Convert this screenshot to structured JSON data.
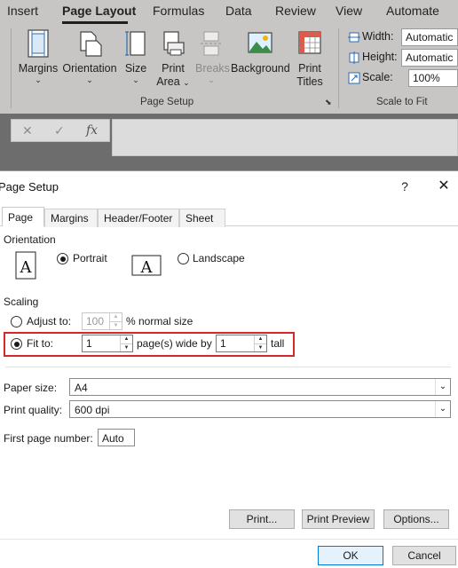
{
  "ribbon": {
    "tabs": [
      {
        "label": "Insert"
      },
      {
        "label": "Page Layout"
      },
      {
        "label": "Formulas"
      },
      {
        "label": "Data"
      },
      {
        "label": "Review"
      },
      {
        "label": "View"
      },
      {
        "label": "Automate"
      }
    ],
    "page_setup": {
      "margins": "Margins",
      "orientation": "Orientation",
      "size": "Size",
      "print_area_1": "Print",
      "print_area_2": "Area",
      "breaks": "Breaks",
      "background": "Background",
      "print_titles_1": "Print",
      "print_titles_2": "Titles",
      "group_label": "Page Setup"
    },
    "scale_to_fit": {
      "width_label": "Width:",
      "width_value": "Automatic",
      "height_label": "Height:",
      "height_value": "Automatic",
      "scale_label": "Scale:",
      "scale_value": "100%",
      "group_label": "Scale to Fit"
    },
    "chevron": "⌄"
  },
  "formula_bar": {
    "cancel": "✕",
    "enter": "✓",
    "fx": "fx"
  },
  "dialog": {
    "title": "Page Setup",
    "help": "?",
    "close": "✕",
    "tabs": [
      {
        "label": "Page"
      },
      {
        "label": "Margins"
      },
      {
        "label": "Header/Footer"
      },
      {
        "label": "Sheet"
      }
    ],
    "orientation": {
      "label": "Orientation",
      "portrait": "Portrait",
      "landscape": "Landscape",
      "selected": "portrait"
    },
    "scaling": {
      "label": "Scaling",
      "adjust_to_label": "Adjust to:",
      "adjust_to_value": "100",
      "adjust_to_suffix": "% normal size",
      "fit_to_label": "Fit to:",
      "fit_wide_value": "1",
      "fit_wide_suffix": "page(s) wide by",
      "fit_tall_value": "1",
      "fit_tall_suffix": "tall",
      "selected": "fit_to"
    },
    "paper_size": {
      "label": "Paper size:",
      "value": "A4"
    },
    "print_quality": {
      "label": "Print quality:",
      "value": "600 dpi"
    },
    "first_page_number": {
      "label": "First page number:",
      "value": "Auto"
    },
    "buttons": {
      "print": "Print...",
      "print_preview": "Print Preview",
      "options": "Options...",
      "ok": "OK",
      "cancel": "Cancel"
    }
  }
}
